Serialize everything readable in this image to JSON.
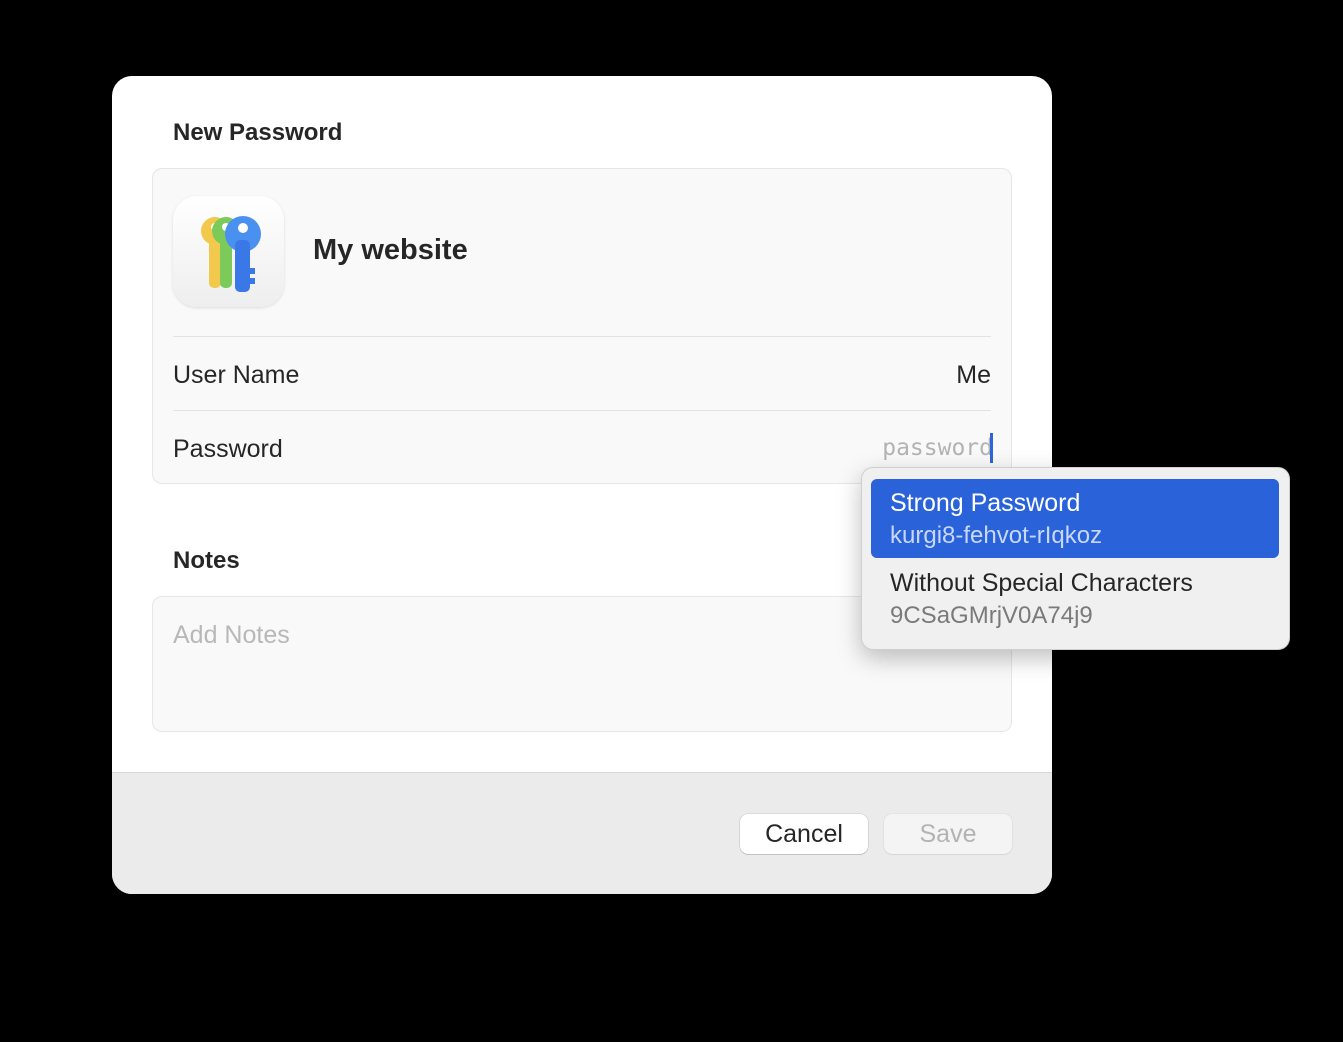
{
  "dialog": {
    "title": "New Password",
    "site_name": "My website",
    "app_icon": "passwords-keys-icon",
    "fields": {
      "username_label": "User Name",
      "username_value": "Me",
      "password_label": "Password",
      "password_value": "",
      "password_placeholder": "password"
    },
    "notes": {
      "title": "Notes",
      "value": "",
      "placeholder": "Add Notes"
    },
    "buttons": {
      "cancel": "Cancel",
      "save": "Save"
    }
  },
  "password_suggestions": [
    {
      "title": "Strong Password",
      "value": "kurgi8-fehvot-rIqkoz",
      "selected": true
    },
    {
      "title": "Without Special Characters",
      "value": "9CSaGMrjV0A74j9",
      "selected": false
    }
  ],
  "colors": {
    "accent": "#2a62da",
    "background": "#000000",
    "dialog": "#ffffff",
    "footer": "#ebebeb"
  }
}
